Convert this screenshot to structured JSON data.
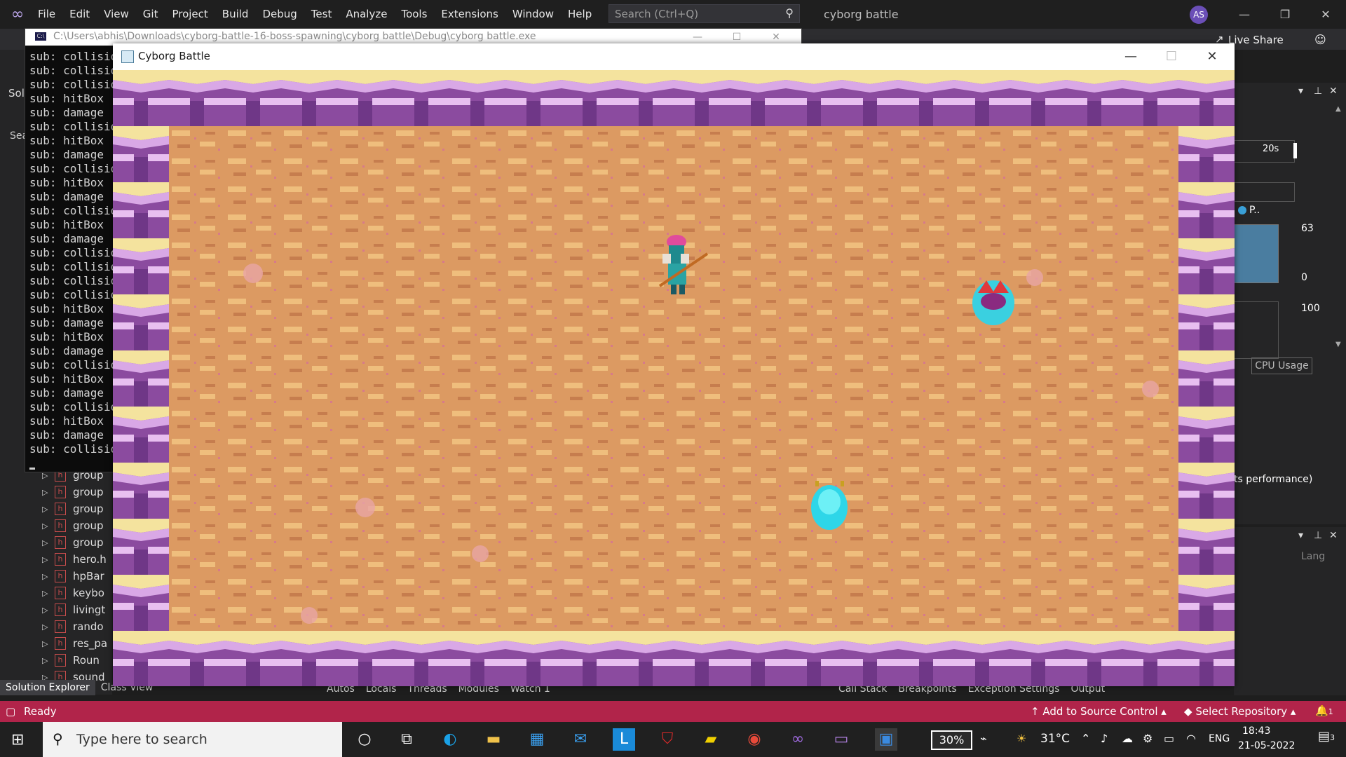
{
  "vs": {
    "menu": [
      "File",
      "Edit",
      "View",
      "Git",
      "Project",
      "Build",
      "Debug",
      "Test",
      "Analyze",
      "Tools",
      "Extensions",
      "Window",
      "Help"
    ],
    "search_placeholder": "Search (Ctrl+Q)",
    "solution_title": "cyborg battle",
    "avatar_initials": "AS",
    "live_share": "Live Share",
    "sol_tab": "Solu",
    "search_tab": "Sea",
    "tree_items": [
      "group",
      "group",
      "group",
      "group",
      "group",
      "hero.h",
      "hpBar",
      "keybo",
      "livingt",
      "rando",
      "res_pa",
      "Roun",
      "sound"
    ],
    "bottom_tabs": [
      "Solution Explorer",
      "Class View"
    ],
    "debug_tabs": [
      "Autos",
      "Locals",
      "Threads",
      "Modules",
      "Watch 1"
    ],
    "debug_tabs_right": [
      "Call Stack",
      "Breakpoints",
      "Exception Settings",
      "Output"
    ],
    "right_panel": {
      "time_label": "20s",
      "process_label": "P..",
      "mem_high": "63",
      "mem_low": "0",
      "cpu_high": "100",
      "tab_label": "CPU Usage",
      "perf_text": "ts performance)",
      "lang_label": "Lang"
    }
  },
  "console": {
    "title": "C:\\Users\\abhis\\Downloads\\cyborg-battle-16-boss-spawning\\cyborg battle\\Debug\\cyborg battle.exe",
    "lines": [
      "sub: collision",
      "sub: collision",
      "sub: collision",
      "sub: hitBox",
      "sub: damage",
      "sub: collision",
      "sub: hitBox",
      "sub: damage",
      "sub: collision",
      "sub: hitBox",
      "sub: damage",
      "sub: collision",
      "sub: hitBox",
      "sub: damage",
      "sub: collision",
      "sub: collision",
      "sub: collision",
      "sub: collision",
      "sub: hitBox",
      "sub: damage",
      "sub: hitBox",
      "sub: damage",
      "sub: collision",
      "sub: hitBox",
      "sub: damage",
      "sub: collision",
      "sub: hitBox",
      "sub: damage",
      "sub: collision"
    ]
  },
  "game": {
    "title": "Cyborg Battle"
  },
  "status": {
    "text": "Ready",
    "source_control": "Add to Source Control",
    "select_repo": "Select Repository",
    "notifications": "1"
  },
  "taskbar": {
    "search_placeholder": "Type here to search",
    "battery": "30%",
    "temperature": "31°C",
    "language": "ENG",
    "time": "18:43",
    "date": "21-05-2022",
    "notif_count": "3"
  },
  "colors": {
    "status_bar": "#b1244a",
    "sand": "#d9965e",
    "wall_purple": "#8a4aa0",
    "wall_light": "#f5e6a8"
  }
}
